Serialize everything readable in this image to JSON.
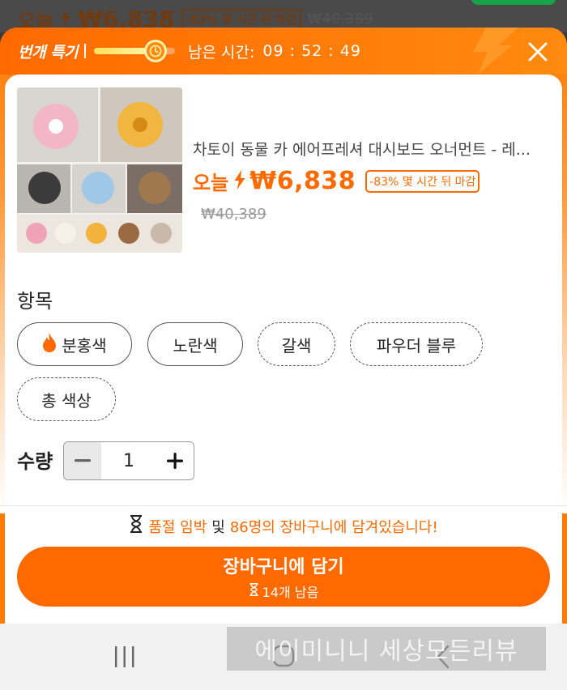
{
  "background_page": {
    "today_label": "오늘",
    "price": "₩6,838",
    "discount_badge": "-83% 몇 시간 뒤 마감",
    "original_price": "₩40,389"
  },
  "flash_header": {
    "title": "번개 특기",
    "remaining_label": "남은 시간:",
    "remaining_time": "09 : 52 : 49",
    "timer_progress": 0.75
  },
  "product": {
    "image_icon": "product-collage-image",
    "title": "차토이 동물 카 에어프레셔 대시보드 오너먼트 - 레...",
    "today_label": "오늘",
    "price": "₩6,838",
    "discount_badge": "-83% 몇 시간 뒤 마감",
    "original_price": "₩40,389"
  },
  "options": {
    "section_label": "항목",
    "items": [
      {
        "label": "분홍색",
        "selected": true,
        "hot": true
      },
      {
        "label": "노란색",
        "selected": false
      },
      {
        "label": "갈색",
        "selected": false
      },
      {
        "label": "파우더 블루",
        "selected": false
      },
      {
        "label": "총 색상",
        "selected": false
      }
    ]
  },
  "quantity": {
    "label": "수량",
    "value": "1"
  },
  "notice": {
    "part1": "품절 임박",
    "part2": "및",
    "part3": "86명의 장바구니에 담겨있습니다!"
  },
  "cart_button": {
    "label": "장바구니에 담기",
    "sub_label": "14개 남음"
  },
  "watermark": "에이미니니 세상모든리뷰",
  "colors": {
    "accent": "#ff6a00",
    "header_gradient_end": "#ff8a10",
    "text_primary": "#222222",
    "text_muted": "#999999"
  }
}
